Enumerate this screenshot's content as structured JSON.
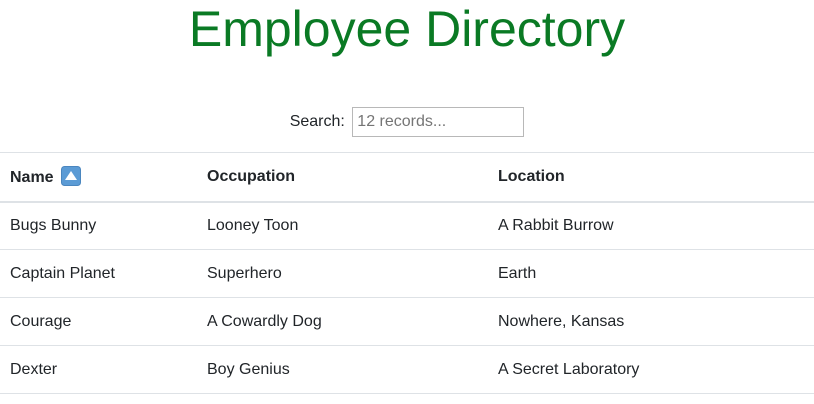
{
  "header": {
    "title": "Employee Directory"
  },
  "search": {
    "label": "Search:",
    "placeholder": "12 records..."
  },
  "table": {
    "columns": [
      {
        "label": "Name",
        "sort_icon": "sort-ascending-icon"
      },
      {
        "label": "Occupation"
      },
      {
        "label": "Location"
      }
    ],
    "rows": [
      {
        "name": "Bugs Bunny",
        "occupation": "Looney Toon",
        "location": "A Rabbit Burrow"
      },
      {
        "name": "Captain Planet",
        "occupation": "Superhero",
        "location": "Earth"
      },
      {
        "name": "Courage",
        "occupation": "A Cowardly Dog",
        "location": "Nowhere, Kansas"
      },
      {
        "name": "Dexter",
        "occupation": "Boy Genius",
        "location": "A Secret Laboratory"
      }
    ]
  },
  "colors": {
    "title": "#0a7a24",
    "sort_icon": "#5b9bd5"
  }
}
